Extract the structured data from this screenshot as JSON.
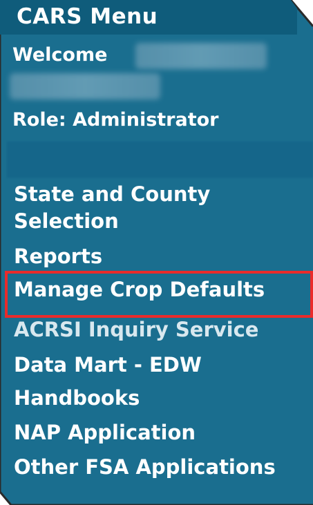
{
  "menu": {
    "title": "CARS Menu",
    "welcome_label": "Welcome",
    "role_label": "Role: Administrator",
    "items": [
      {
        "label": "State and County Selection"
      },
      {
        "label": "Reports"
      },
      {
        "label": "Manage Crop Defaults"
      },
      {
        "label": "ACRSI Inquiry Service"
      },
      {
        "label": "Data Mart - EDW"
      },
      {
        "label": "Handbooks"
      },
      {
        "label": "NAP Application"
      },
      {
        "label": "Other FSA Applications"
      }
    ]
  },
  "colors": {
    "panel": "#1a6e8f",
    "header": "#0f5c7b",
    "highlight": "#ea2b2b",
    "text": "#ffffff"
  }
}
